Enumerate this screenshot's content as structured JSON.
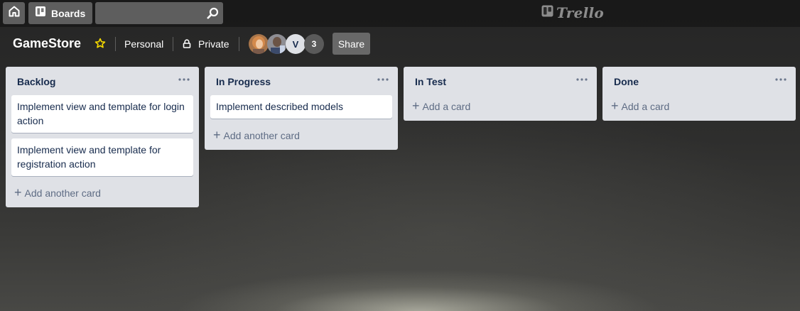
{
  "topbar": {
    "home_icon": "home-icon",
    "boards_label": "Boards",
    "search_value": "",
    "search_placeholder": "",
    "logo_text": "Trello"
  },
  "board": {
    "title": "GameStore",
    "starred": true,
    "team": "Personal",
    "visibility": "Private",
    "members": [
      {
        "type": "photo",
        "icon": "avatar-photo-1"
      },
      {
        "type": "photo",
        "icon": "avatar-photo-2"
      },
      {
        "type": "initial",
        "text": "V"
      }
    ],
    "extra_members": "3",
    "share_label": "Share"
  },
  "lists": [
    {
      "title": "Backlog",
      "cards": [
        "Implement view and template for login action",
        "Implement view and template for registration action"
      ],
      "add_label": "Add another card"
    },
    {
      "title": "In Progress",
      "cards": [
        "Implement described models"
      ],
      "add_label": "Add another card"
    },
    {
      "title": "In Test",
      "cards": [],
      "add_label": "Add a card"
    },
    {
      "title": "Done",
      "cards": [],
      "add_label": "Add a card"
    }
  ],
  "colors": {
    "list_bg": "#dfe1e6",
    "card_text": "#172b4d",
    "muted_text": "#5e6c84",
    "star": "#f2d600"
  }
}
